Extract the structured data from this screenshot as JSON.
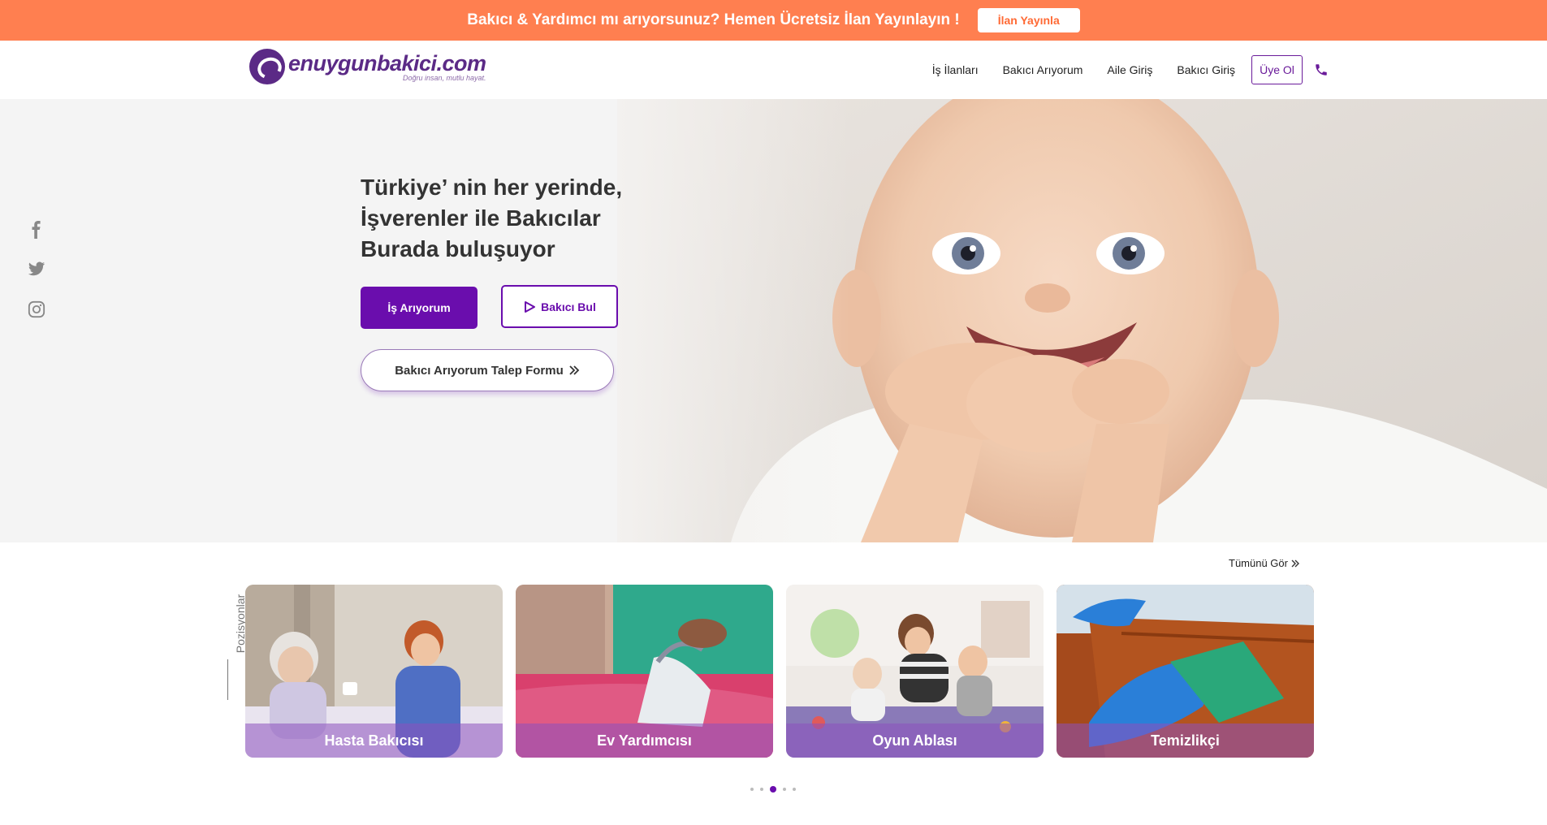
{
  "promo": {
    "text": "Bakıcı & Yardımcı mı arıyorsunuz? Hemen Ücretsiz İlan Yayınlayın !",
    "button": "İlan Yayınla"
  },
  "header": {
    "logo_name": "enuygunbakici.com",
    "logo_tagline": "Doğru insan, mutlu hayat.",
    "nav": [
      "İş İlanları",
      "Bakıcı Arıyorum",
      "Aile Giriş",
      "Bakıcı Giriş"
    ],
    "signup": "Üye Ol"
  },
  "hero": {
    "title_line1": "Türkiye’ nin her yerinde,",
    "title_line2": "İşverenler ile Bakıcılar",
    "title_line3": "Burada buluşuyor",
    "btn_job": "İş Arıyorum",
    "btn_find": "Bakıcı Bul",
    "btn_form": "Bakıcı Arıyorum Talep Formu"
  },
  "positions": {
    "section_label": "Pozisyonlar",
    "see_all": "Tümünü Gör",
    "cards": [
      {
        "label": "Hasta Bakıcısı"
      },
      {
        "label": "Ev Yardımcısı"
      },
      {
        "label": "Oyun Ablası"
      },
      {
        "label": "Temizlikçi"
      }
    ],
    "active_dot": 2
  },
  "colors": {
    "promo": "#ff7f50",
    "brand": "#6a0dad",
    "logo": "#5b2a86"
  }
}
